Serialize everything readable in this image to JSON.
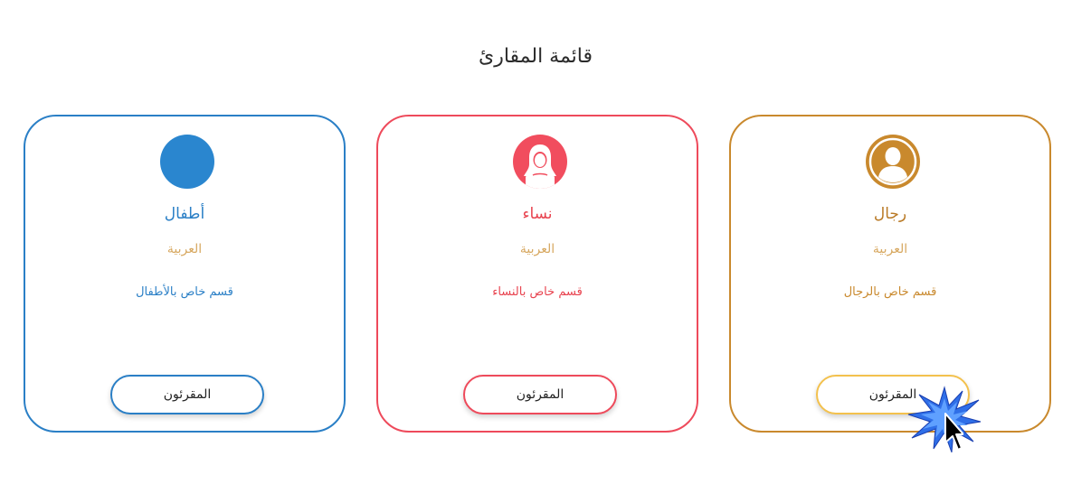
{
  "page_title": "قائمة المقارئ",
  "cards": [
    {
      "id": "kids",
      "title": "أطفال",
      "language": "العربية",
      "description": "قسم خاص بالأطفال",
      "button_label": "المقرئون",
      "accent_color": "#2a7fc6",
      "icon": "blank-avatar-icon"
    },
    {
      "id": "women",
      "title": "نساء",
      "language": "العربية",
      "description": "قسم خاص بالنساء",
      "button_label": "المقرئون",
      "accent_color": "#ee4a5b",
      "icon": "woman-hijab-avatar-icon"
    },
    {
      "id": "men",
      "title": "رجال",
      "language": "العربية",
      "description": "قسم خاص بالرجال",
      "button_label": "المقرئون",
      "accent_color": "#c9892d",
      "icon": "man-avatar-icon"
    }
  ],
  "cursor": {
    "icon": "arrow-cursor-icon",
    "effect": "click-burst-icon",
    "effect_color": "#2f6fe8"
  }
}
